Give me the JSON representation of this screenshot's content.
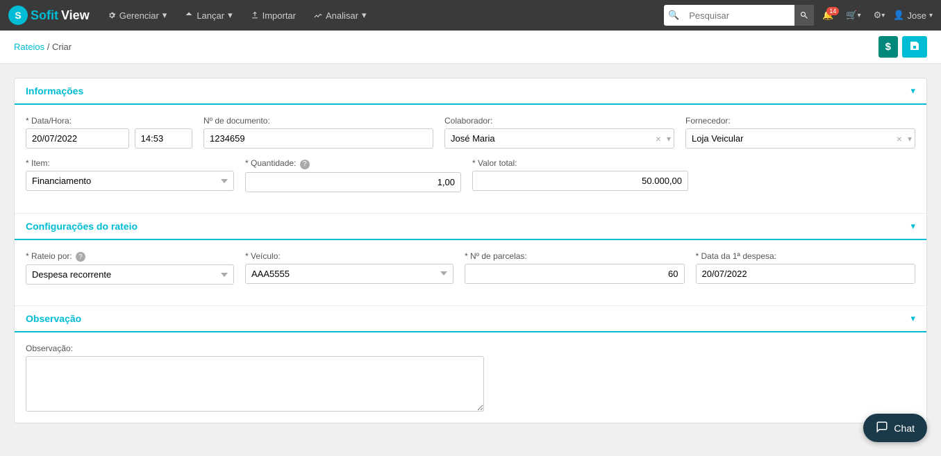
{
  "brand": {
    "sofit": "Sofit",
    "view": "View"
  },
  "navbar": {
    "items": [
      {
        "label": "Gerenciar",
        "icon": "gear"
      },
      {
        "label": "Lançar",
        "icon": "arrow"
      },
      {
        "label": "Importar",
        "icon": "upload"
      },
      {
        "label": "Analisar",
        "icon": "chart"
      }
    ],
    "search_placeholder": "Pesquisar",
    "notification_badge": "14",
    "user": "Jose"
  },
  "breadcrumb": {
    "parent": "Rateios",
    "current": "Criar"
  },
  "sections": {
    "informacoes": {
      "title": "Informações",
      "fields": {
        "data_hora_label": "* Data/Hora:",
        "data_value": "20/07/2022",
        "hora_value": "14:53",
        "num_doc_label": "Nº de documento:",
        "num_doc_value": "1234659",
        "colaborador_label": "Colaborador:",
        "colaborador_value": "José Maria",
        "fornecedor_label": "Fornecedor:",
        "fornecedor_value": "Loja Veicular",
        "item_label": "* Item:",
        "item_value": "Financiamento",
        "quantidade_label": "* Quantidade:",
        "quantidade_value": "1,00",
        "valor_total_label": "* Valor total:",
        "valor_total_value": "50.000,00"
      }
    },
    "configuracoes": {
      "title": "Configurações do rateio",
      "fields": {
        "rateio_por_label": "* Rateio por:",
        "rateio_por_value": "Despesa recorrente",
        "veiculo_label": "* Veículo:",
        "veiculo_value": "AAA5555",
        "num_parcelas_label": "* Nº de parcelas:",
        "num_parcelas_value": "60",
        "data_1a_label": "* Data da 1ª despesa:",
        "data_1a_value": "20/07/2022"
      }
    },
    "observacao": {
      "title": "Observação",
      "fields": {
        "obs_label": "Observação:",
        "obs_value": ""
      }
    }
  },
  "buttons": {
    "dollar": "$",
    "save": "💾",
    "chat": "Chat"
  }
}
